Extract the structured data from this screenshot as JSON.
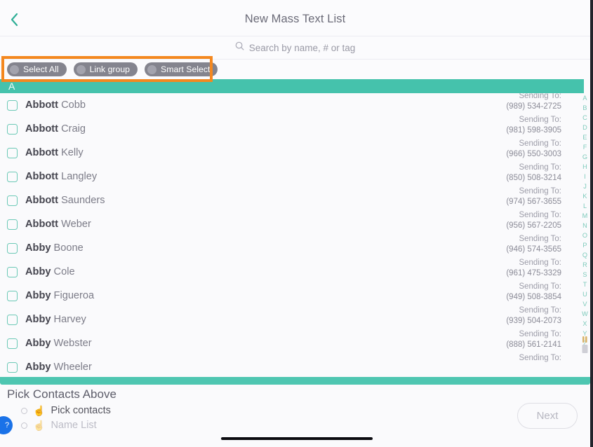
{
  "header": {
    "back_icon": "chevron-left-icon",
    "title": "New Mass Text List"
  },
  "search": {
    "icon": "search-icon",
    "placeholder": "Search by name, # or tag",
    "value": ""
  },
  "action_pills": [
    {
      "label": "Select All"
    },
    {
      "label": "Link group"
    },
    {
      "label": "Smart Select"
    }
  ],
  "annotation": {
    "color": "#f4881f",
    "target": "action-pills-row"
  },
  "section": {
    "letter": "A"
  },
  "contacts": [
    {
      "first": "Abbott",
      "last": "Cobb",
      "sending_to_label": "Sending To:",
      "phone": "(989) 534-2725",
      "checked": false
    },
    {
      "first": "Abbott",
      "last": "Craig",
      "sending_to_label": "Sending To:",
      "phone": "(981) 598-3905",
      "checked": false
    },
    {
      "first": "Abbott",
      "last": "Kelly",
      "sending_to_label": "Sending To:",
      "phone": "(966) 550-3003",
      "checked": false
    },
    {
      "first": "Abbott",
      "last": "Langley",
      "sending_to_label": "Sending To:",
      "phone": "(850) 508-3214",
      "checked": false
    },
    {
      "first": "Abbott",
      "last": "Saunders",
      "sending_to_label": "Sending To:",
      "phone": "(974) 567-3655",
      "checked": false
    },
    {
      "first": "Abbott",
      "last": "Weber",
      "sending_to_label": "Sending To:",
      "phone": "(956) 567-2205",
      "checked": false
    },
    {
      "first": "Abby",
      "last": "Boone",
      "sending_to_label": "Sending To:",
      "phone": "(946) 574-3565",
      "checked": false
    },
    {
      "first": "Abby",
      "last": "Cole",
      "sending_to_label": "Sending To:",
      "phone": "(961) 475-3329",
      "checked": false
    },
    {
      "first": "Abby",
      "last": "Figueroa",
      "sending_to_label": "Sending To:",
      "phone": "(949) 508-3854",
      "checked": false
    },
    {
      "first": "Abby",
      "last": "Harvey",
      "sending_to_label": "Sending To:",
      "phone": "(939) 504-2073",
      "checked": false
    },
    {
      "first": "Abby",
      "last": "Webster",
      "sending_to_label": "Sending To:",
      "phone": "(888) 561-2141",
      "checked": false
    },
    {
      "first": "Abby",
      "last": "Wheeler",
      "sending_to_label": "Sending To:",
      "phone": "",
      "checked": false
    }
  ],
  "alphabet_index": [
    "A",
    "B",
    "C",
    "D",
    "E",
    "F",
    "G",
    "H",
    "I",
    "J",
    "K",
    "L",
    "M",
    "N",
    "O",
    "P",
    "Q",
    "R",
    "S",
    "T",
    "U",
    "V",
    "W",
    "X",
    "Y",
    "Z"
  ],
  "bottom": {
    "title": "Pick Contacts Above",
    "options": [
      {
        "emoji": "☝️",
        "label": "Pick contacts",
        "selected": false,
        "disabled": false
      },
      {
        "emoji": "☝️",
        "label": "Name List",
        "selected": false,
        "disabled": true
      }
    ],
    "next_label": "Next",
    "help_label": "?"
  },
  "colors": {
    "accent_teal": "#45c2ac",
    "annotation_orange": "#f4881f",
    "help_blue": "#1a72e8",
    "pill_gray": "#84848e"
  }
}
